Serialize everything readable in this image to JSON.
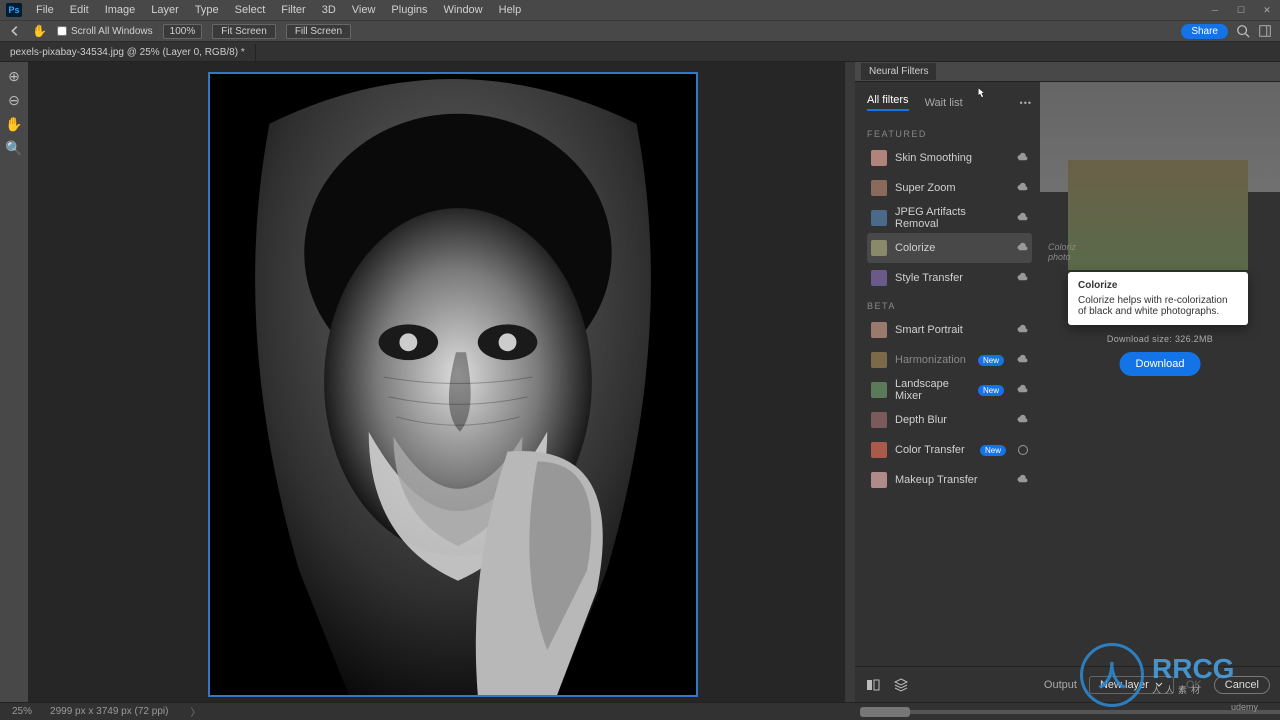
{
  "menu": [
    "File",
    "Edit",
    "Image",
    "Layer",
    "Type",
    "Select",
    "Filter",
    "3D",
    "View",
    "Plugins",
    "Window",
    "Help"
  ],
  "ps_badge": "Ps",
  "options": {
    "scroll_all": "Scroll All Windows",
    "zoom": "100%",
    "fit_screen": "Fit Screen",
    "fill_screen": "Fill Screen",
    "share": "Share"
  },
  "doc_tab": "pexels-pixabay-34534.jpg @ 25% (Layer 0, RGB/8) *",
  "tools": [
    "⊕",
    "⊖",
    "✋",
    "🔍"
  ],
  "panel": {
    "title": "Neural Filters",
    "tabs": {
      "all": "All filters",
      "wait": "Wait list"
    },
    "sections": {
      "featured": "FEATURED",
      "beta": "BETA"
    },
    "featured": [
      {
        "name": "Skin Smoothing",
        "cloud": true
      },
      {
        "name": "Super Zoom",
        "cloud": true
      },
      {
        "name": "JPEG Artifacts Removal",
        "cloud": true
      },
      {
        "name": "Colorize",
        "cloud": true,
        "selected": true
      },
      {
        "name": "Style Transfer",
        "cloud": true
      }
    ],
    "beta": [
      {
        "name": "Smart Portrait",
        "cloud": true
      },
      {
        "name": "Harmonization",
        "cloud": true,
        "new": true,
        "dim": true
      },
      {
        "name": "Landscape Mixer",
        "cloud": true,
        "new": true
      },
      {
        "name": "Depth Blur",
        "cloud": true
      },
      {
        "name": "Color Transfer",
        "radio": true,
        "new": true
      },
      {
        "name": "Makeup Transfer",
        "cloud": true
      }
    ],
    "new_badge": "New"
  },
  "tooltip": {
    "title": "Colorize",
    "body": "Colorize helps with re-colorization of black and white photographs.",
    "download_size": "Download size: 326.2MB",
    "download": "Download"
  },
  "footer": {
    "output": "Output",
    "output_val": "New layer",
    "ok": "OK",
    "cancel": "Cancel"
  },
  "status": {
    "zoom": "25%",
    "dims": "2999 px x 3749 px (72 ppi)"
  },
  "watermark": {
    "logo": "人",
    "main": "RRCG",
    "sub": "人人素材",
    "udemy": "udemy"
  }
}
